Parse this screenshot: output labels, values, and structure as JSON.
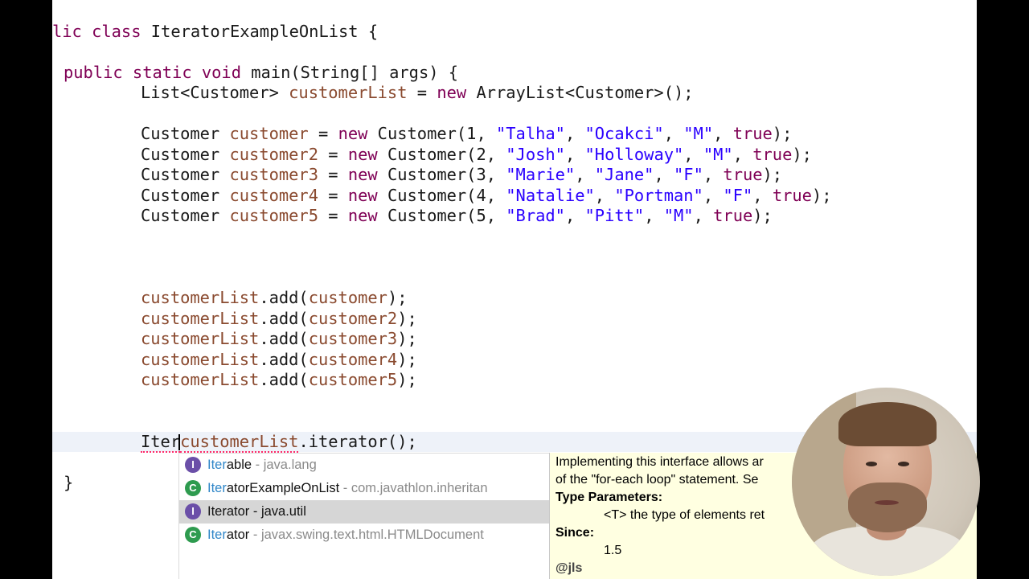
{
  "code": {
    "class_decl_a": "lic class ",
    "class_name": "IteratorExampleOnList",
    "class_decl_b": " {",
    "main_kw": "public static void ",
    "main_rest": "main(String[] args) {",
    "list_type": "List<Customer> ",
    "list_var": "customerList",
    "list_eq": " = ",
    "list_new": "new",
    "list_rest": " ArrayList<Customer>();",
    "customers": [
      {
        "type": "Customer ",
        "var": "customer",
        "eq": " = ",
        "new": "new",
        "ctor": " Customer(1, ",
        "s1": "\"Talha\"",
        "c1": ", ",
        "s2": "\"Ocakci\"",
        "c2": ", ",
        "s3": "\"M\"",
        "c3": ", ",
        "tru": "true",
        "end": ");"
      },
      {
        "type": "Customer ",
        "var": "customer2",
        "eq": " = ",
        "new": "new",
        "ctor": " Customer(2, ",
        "s1": "\"Josh\"",
        "c1": ", ",
        "s2": "\"Holloway\"",
        "c2": ", ",
        "s3": "\"M\"",
        "c3": ", ",
        "tru": "true",
        "end": ");"
      },
      {
        "type": "Customer ",
        "var": "customer3",
        "eq": " = ",
        "new": "new",
        "ctor": " Customer(3, ",
        "s1": "\"Marie\"",
        "c1": ", ",
        "s2": "\"Jane\"",
        "c2": ", ",
        "s3": "\"F\"",
        "c3": ", ",
        "tru": "true",
        "end": ");"
      },
      {
        "type": "Customer ",
        "var": "customer4",
        "eq": " = ",
        "new": "new",
        "ctor": " Customer(4, ",
        "s1": "\"Natalie\"",
        "c1": ", ",
        "s2": "\"Portman\"",
        "c2": ", ",
        "s3": "\"F\"",
        "c3": ", ",
        "tru": "true",
        "end": ");"
      },
      {
        "type": "Customer ",
        "var": "customer5",
        "eq": " = ",
        "new": "new",
        "ctor": " Customer(5, ",
        "s1": "\"Brad\"",
        "c1": ", ",
        "s2": "\"Pitt\"",
        "c2": ", ",
        "s3": "\"M\"",
        "c3": ", ",
        "tru": "true",
        "end": ");"
      }
    ],
    "adds": [
      {
        "recv": "customerList",
        "mid": ".add(",
        "arg": "customer",
        "end": ");"
      },
      {
        "recv": "customerList",
        "mid": ".add(",
        "arg": "customer2",
        "end": ");"
      },
      {
        "recv": "customerList",
        "mid": ".add(",
        "arg": "customer3",
        "end": ");"
      },
      {
        "recv": "customerList",
        "mid": ".add(",
        "arg": "customer4",
        "end": ");"
      },
      {
        "recv": "customerList",
        "mid": ".add(",
        "arg": "customer5",
        "end": ");"
      }
    ],
    "current_typed": "Iter",
    "current_var": "customerList",
    "current_rest": ".iterator();",
    "closing_brace": "}"
  },
  "content_assist": {
    "proposals": [
      {
        "icon": "I",
        "kind": "interface",
        "match": "Iter",
        "rest": "able",
        "pkg": " - java.lang",
        "selected": false
      },
      {
        "icon": "C",
        "kind": "class",
        "match": "Iter",
        "rest": "atorExampleOnList",
        "pkg": " - com.javathlon.inheritan",
        "selected": false
      },
      {
        "icon": "I",
        "kind": "interface",
        "match": "Iter",
        "rest": "ator",
        "pkg": " - java.util",
        "selected": true
      },
      {
        "icon": "C",
        "kind": "class",
        "match": "Iter",
        "rest": "ator",
        "pkg": " - javax.swing.text.html.HTMLDocument",
        "selected": false
      }
    ]
  },
  "javadoc": {
    "line1": "Implementing this interface allows ar",
    "line2": "of the \"for-each loop\" statement. Se",
    "type_params_label": "Type Parameters:",
    "type_param": "<T> the type of elements ret",
    "since_label": "Since:",
    "since_value": "1.5",
    "jls": "@jls"
  },
  "colors": {
    "keyword": "#7f0055",
    "variable": "#8a4a2f",
    "string": "#2a00ff",
    "match": "#2f86c8",
    "doc_bg": "#ffffe1",
    "selection": "#d6d6d6"
  }
}
